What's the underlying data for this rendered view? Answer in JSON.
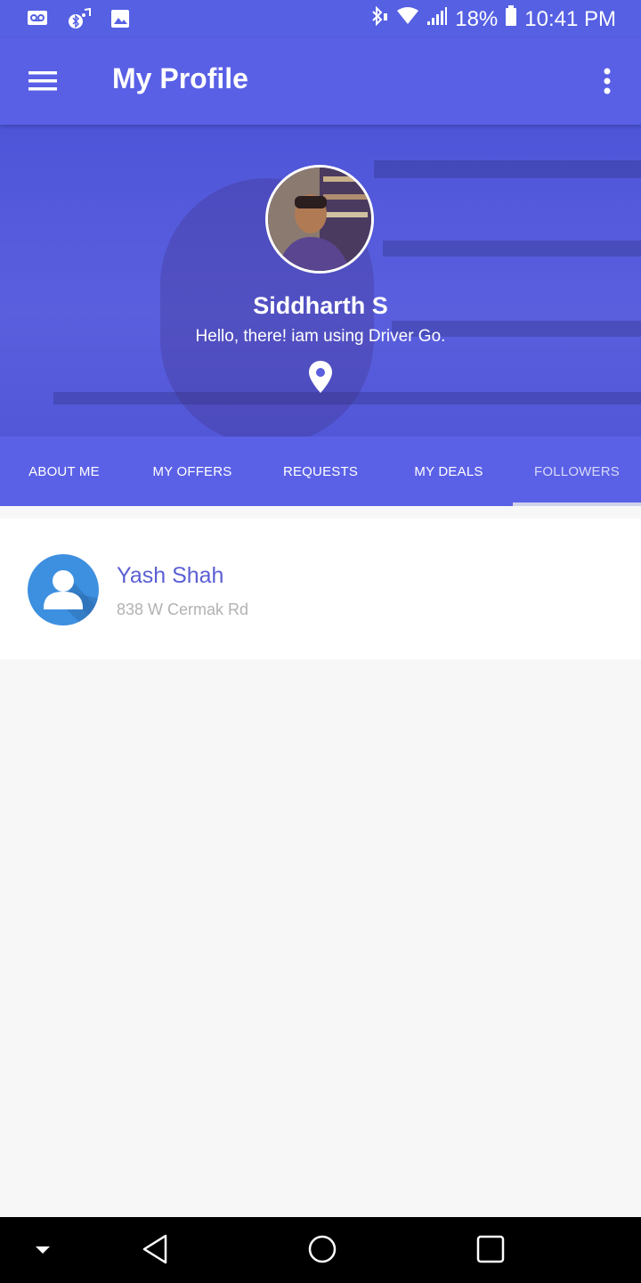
{
  "status_bar": {
    "battery": "18%",
    "time": "10:41 PM",
    "icons": [
      "voicemail-icon",
      "bluetooth-music-icon",
      "image-icon",
      "bluetooth-icon",
      "wifi-icon",
      "signal-icon",
      "battery-icon"
    ]
  },
  "app_bar": {
    "title": "My Profile",
    "menu_icon": "hamburger-menu-icon",
    "more_icon": "more-vert-icon"
  },
  "profile": {
    "name": "Siddharth S",
    "status": "Hello, there! iam using Driver Go.",
    "location_icon": "location-pin-icon"
  },
  "tabs": [
    {
      "label": "ABOUT ME",
      "active": false
    },
    {
      "label": "MY OFFERS",
      "active": false
    },
    {
      "label": "REQUESTS",
      "active": false
    },
    {
      "label": "MY DEALS",
      "active": false
    },
    {
      "label": "FOLLOWERS",
      "active": true
    }
  ],
  "followers": [
    {
      "name": "Yash Shah",
      "address": "838 W Cermak Rd",
      "avatar_icon": "person-avatar-icon"
    }
  ],
  "colors": {
    "primary": "#5960e6",
    "accent_text": "#5b5fd4",
    "avatar_blue": "#3d8fe0"
  },
  "nav_bar": [
    "hide-keyboard-icon",
    "back-icon",
    "home-icon",
    "recents-icon"
  ]
}
